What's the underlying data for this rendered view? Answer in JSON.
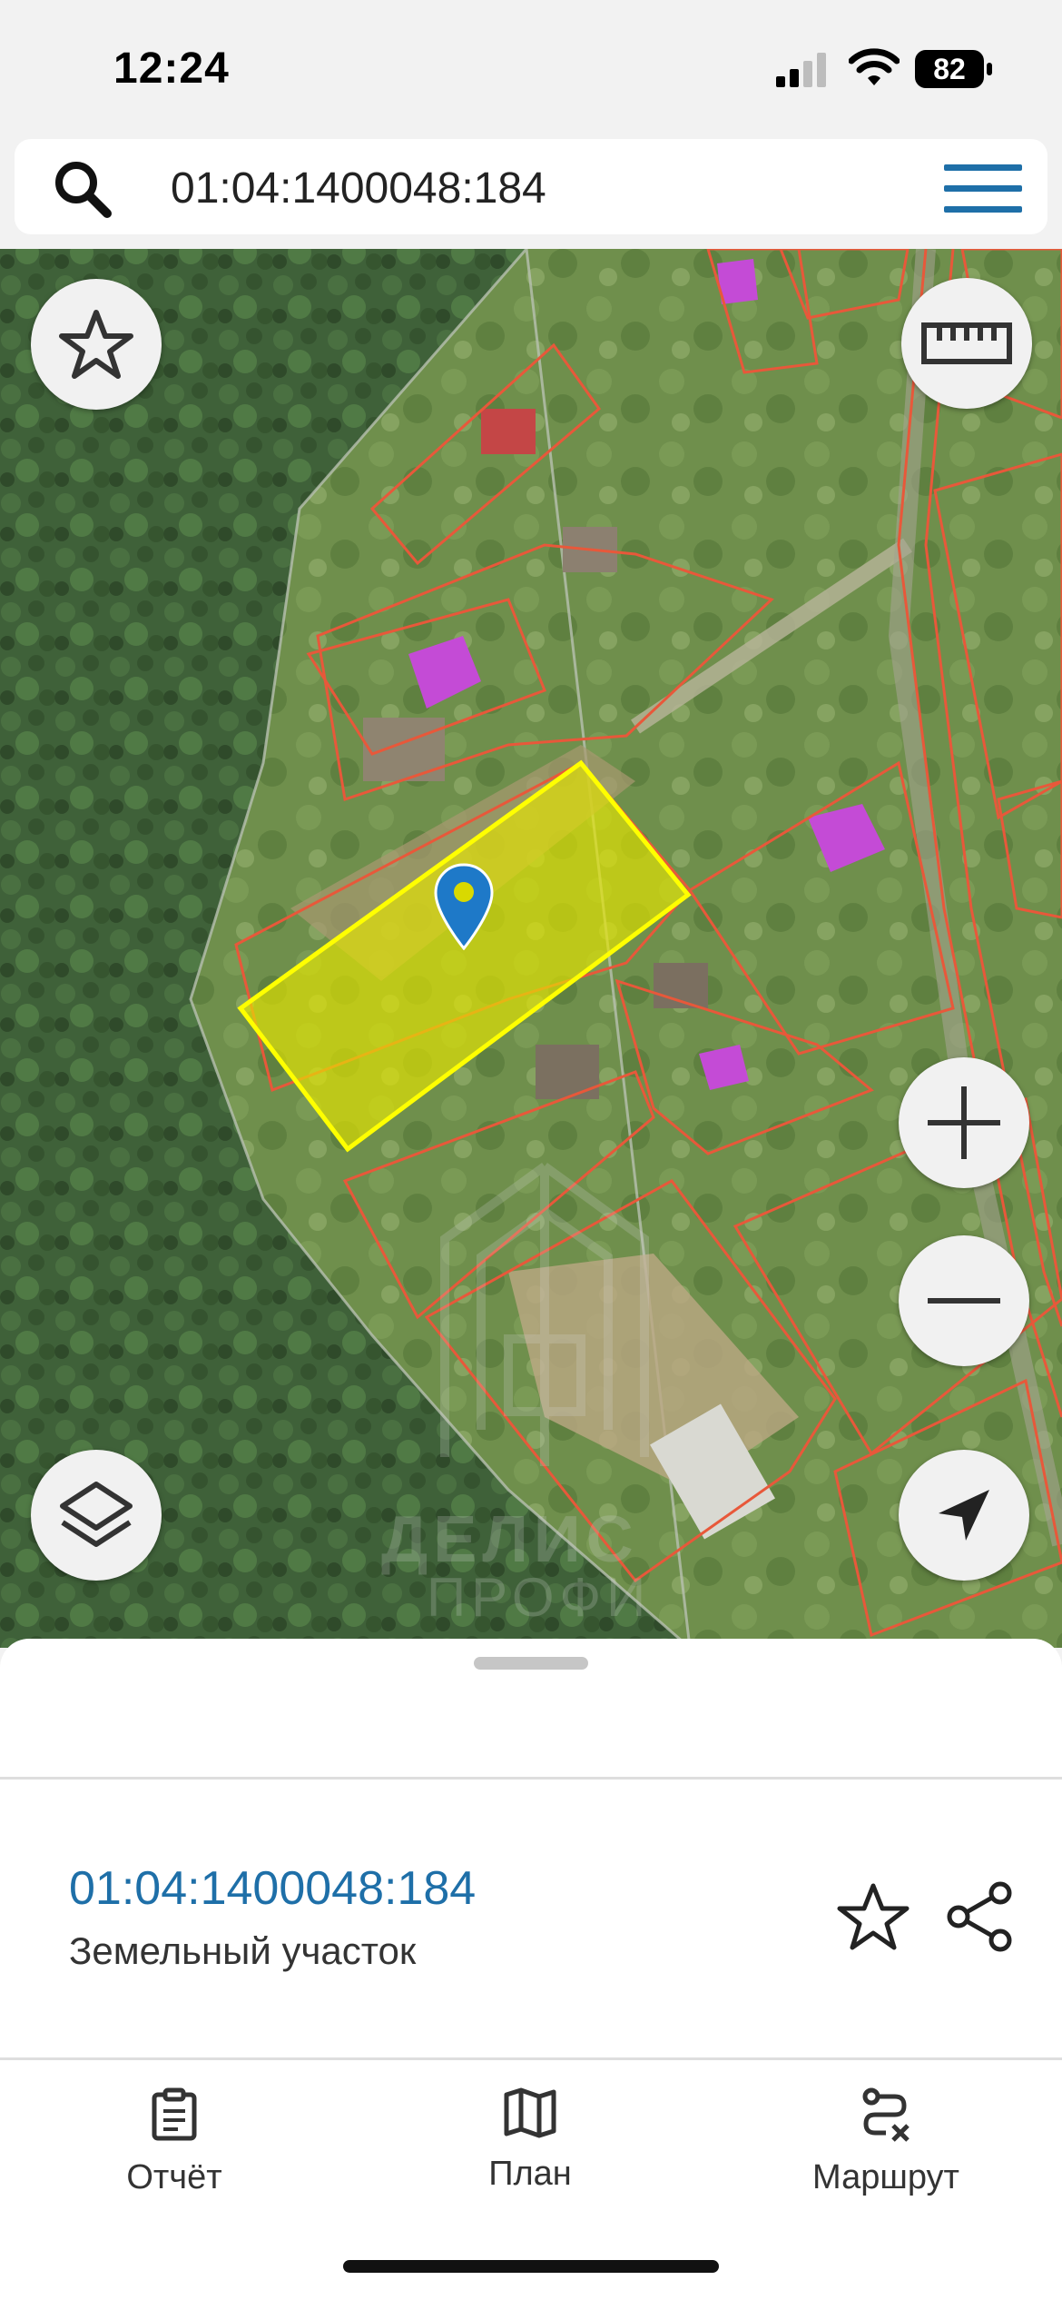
{
  "status_bar": {
    "time": "12:24",
    "battery": "82"
  },
  "search": {
    "query": "01:04:1400048:184"
  },
  "parcel": {
    "id": "01:04:1400048:184",
    "type": "Земельный участок"
  },
  "watermark": {
    "line1": "ДЕЛИС",
    "line2": "ПРОФИ"
  },
  "tabs": [
    {
      "label": "Отчёт",
      "icon": "report-icon"
    },
    {
      "label": "План",
      "icon": "map-plan-icon"
    },
    {
      "label": "Маршрут",
      "icon": "route-icon"
    }
  ],
  "map_buttons": [
    "star-icon",
    "ruler-icon",
    "layers-icon",
    "zoom-in-icon",
    "zoom-out-icon",
    "location-arrow-icon"
  ],
  "colors": {
    "accent": "#1e6fa8",
    "parcel_border": "#e8583a",
    "selected_fill": "#e6e600",
    "selected_border": "#ffff00",
    "building": "#c44bd6"
  }
}
